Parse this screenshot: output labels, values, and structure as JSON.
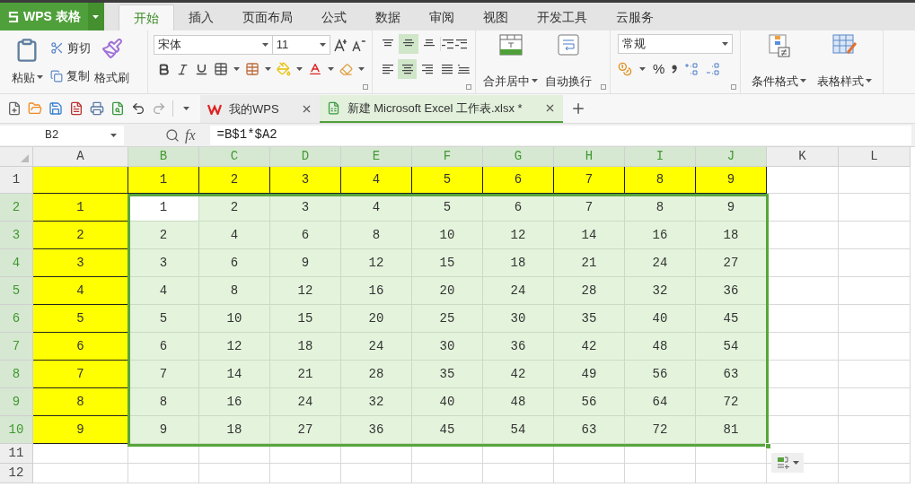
{
  "app": {
    "title": "WPS 表格"
  },
  "ribbon_tabs": [
    {
      "label": "开始",
      "selected": true
    },
    {
      "label": "插入",
      "selected": false
    },
    {
      "label": "页面布局",
      "selected": false
    },
    {
      "label": "公式",
      "selected": false
    },
    {
      "label": "数据",
      "selected": false
    },
    {
      "label": "审阅",
      "selected": false
    },
    {
      "label": "视图",
      "selected": false
    },
    {
      "label": "开发工具",
      "selected": false
    },
    {
      "label": "云服务",
      "selected": false
    }
  ],
  "clipboard": {
    "paste": "粘贴",
    "cut": "剪切",
    "copy": "复制",
    "format_painter": "格式刷"
  },
  "font": {
    "name": "宋体",
    "size": "11"
  },
  "horizontal_align": [
    {
      "selected": false
    },
    {
      "selected": true
    },
    {
      "selected": false
    },
    {
      "selected": false
    }
  ],
  "vertical_align": [
    {
      "selected": false
    },
    {
      "selected": true
    },
    {
      "selected": false
    }
  ],
  "alignment": {
    "merge": "合并居中",
    "wrap": "自动换行"
  },
  "number": {
    "format": "常规",
    "percent": "%"
  },
  "styles": {
    "conditional": "条件格式",
    "table_style": "表格样式"
  },
  "doc_tabs": [
    {
      "title": "我的WPS",
      "kind": "home",
      "selected": false
    },
    {
      "title": "新建 Microsoft Excel 工作表.xlsx *",
      "kind": "sheet",
      "selected": true
    }
  ],
  "formula_bar": {
    "name_box": "B2",
    "fx": "fx",
    "formula": "=B$1*$A2"
  },
  "columns": [
    {
      "label": "A",
      "in_selection": false
    },
    {
      "label": "B",
      "in_selection": true
    },
    {
      "label": "C",
      "in_selection": true
    },
    {
      "label": "D",
      "in_selection": true
    },
    {
      "label": "E",
      "in_selection": true
    },
    {
      "label": "F",
      "in_selection": true
    },
    {
      "label": "G",
      "in_selection": true
    },
    {
      "label": "H",
      "in_selection": true
    },
    {
      "label": "I",
      "in_selection": true
    },
    {
      "label": "J",
      "in_selection": true
    },
    {
      "label": "K",
      "in_selection": false
    },
    {
      "label": "L",
      "in_selection": false
    }
  ],
  "rows": [
    {
      "label": "1",
      "in_selection": false,
      "cells": [
        {
          "highlight": true
        },
        {
          "value": "1",
          "highlight": true
        },
        {
          "value": "2",
          "highlight": true
        },
        {
          "value": "3",
          "highlight": true
        },
        {
          "value": "4",
          "highlight": true
        },
        {
          "value": "5",
          "highlight": true
        },
        {
          "value": "6",
          "highlight": true
        },
        {
          "value": "7",
          "highlight": true
        },
        {
          "value": "8",
          "highlight": true
        },
        {
          "value": "9",
          "highlight": true
        },
        {},
        {}
      ]
    },
    {
      "label": "2",
      "in_selection": true,
      "cells": [
        {
          "value": "1",
          "highlight": true
        },
        {
          "value": "1",
          "in_selection": true,
          "selected": true
        },
        {
          "value": "2",
          "in_selection": true
        },
        {
          "value": "3",
          "in_selection": true
        },
        {
          "value": "4",
          "in_selection": true
        },
        {
          "value": "5",
          "in_selection": true
        },
        {
          "value": "6",
          "in_selection": true
        },
        {
          "value": "7",
          "in_selection": true
        },
        {
          "value": "8",
          "in_selection": true
        },
        {
          "value": "9",
          "in_selection": true
        },
        {},
        {}
      ]
    },
    {
      "label": "3",
      "in_selection": true,
      "cells": [
        {
          "value": "2",
          "highlight": true
        },
        {
          "value": "2",
          "in_selection": true
        },
        {
          "value": "4",
          "in_selection": true
        },
        {
          "value": "6",
          "in_selection": true
        },
        {
          "value": "8",
          "in_selection": true
        },
        {
          "value": "10",
          "in_selection": true
        },
        {
          "value": "12",
          "in_selection": true
        },
        {
          "value": "14",
          "in_selection": true
        },
        {
          "value": "16",
          "in_selection": true
        },
        {
          "value": "18",
          "in_selection": true
        },
        {},
        {}
      ]
    },
    {
      "label": "4",
      "in_selection": true,
      "cells": [
        {
          "value": "3",
          "highlight": true
        },
        {
          "value": "3",
          "in_selection": true
        },
        {
          "value": "6",
          "in_selection": true
        },
        {
          "value": "9",
          "in_selection": true
        },
        {
          "value": "12",
          "in_selection": true
        },
        {
          "value": "15",
          "in_selection": true
        },
        {
          "value": "18",
          "in_selection": true
        },
        {
          "value": "21",
          "in_selection": true
        },
        {
          "value": "24",
          "in_selection": true
        },
        {
          "value": "27",
          "in_selection": true
        },
        {},
        {}
      ]
    },
    {
      "label": "5",
      "in_selection": true,
      "cells": [
        {
          "value": "4",
          "highlight": true
        },
        {
          "value": "4",
          "in_selection": true
        },
        {
          "value": "8",
          "in_selection": true
        },
        {
          "value": "12",
          "in_selection": true
        },
        {
          "value": "16",
          "in_selection": true
        },
        {
          "value": "20",
          "in_selection": true
        },
        {
          "value": "24",
          "in_selection": true
        },
        {
          "value": "28",
          "in_selection": true
        },
        {
          "value": "32",
          "in_selection": true
        },
        {
          "value": "36",
          "in_selection": true
        },
        {},
        {}
      ]
    },
    {
      "label": "6",
      "in_selection": true,
      "cells": [
        {
          "value": "5",
          "highlight": true
        },
        {
          "value": "5",
          "in_selection": true
        },
        {
          "value": "10",
          "in_selection": true
        },
        {
          "value": "15",
          "in_selection": true
        },
        {
          "value": "20",
          "in_selection": true
        },
        {
          "value": "25",
          "in_selection": true
        },
        {
          "value": "30",
          "in_selection": true
        },
        {
          "value": "35",
          "in_selection": true
        },
        {
          "value": "40",
          "in_selection": true
        },
        {
          "value": "45",
          "in_selection": true
        },
        {},
        {}
      ]
    },
    {
      "label": "7",
      "in_selection": true,
      "cells": [
        {
          "value": "6",
          "highlight": true
        },
        {
          "value": "6",
          "in_selection": true
        },
        {
          "value": "12",
          "in_selection": true
        },
        {
          "value": "18",
          "in_selection": true
        },
        {
          "value": "24",
          "in_selection": true
        },
        {
          "value": "30",
          "in_selection": true
        },
        {
          "value": "36",
          "in_selection": true
        },
        {
          "value": "42",
          "in_selection": true
        },
        {
          "value": "48",
          "in_selection": true
        },
        {
          "value": "54",
          "in_selection": true
        },
        {},
        {}
      ]
    },
    {
      "label": "8",
      "in_selection": true,
      "cells": [
        {
          "value": "7",
          "highlight": true
        },
        {
          "value": "7",
          "in_selection": true
        },
        {
          "value": "14",
          "in_selection": true
        },
        {
          "value": "21",
          "in_selection": true
        },
        {
          "value": "28",
          "in_selection": true
        },
        {
          "value": "35",
          "in_selection": true
        },
        {
          "value": "42",
          "in_selection": true
        },
        {
          "value": "49",
          "in_selection": true
        },
        {
          "value": "56",
          "in_selection": true
        },
        {
          "value": "63",
          "in_selection": true
        },
        {},
        {}
      ]
    },
    {
      "label": "9",
      "in_selection": true,
      "cells": [
        {
          "value": "8",
          "highlight": true
        },
        {
          "value": "8",
          "in_selection": true
        },
        {
          "value": "16",
          "in_selection": true
        },
        {
          "value": "24",
          "in_selection": true
        },
        {
          "value": "32",
          "in_selection": true
        },
        {
          "value": "40",
          "in_selection": true
        },
        {
          "value": "48",
          "in_selection": true
        },
        {
          "value": "56",
          "in_selection": true
        },
        {
          "value": "64",
          "in_selection": true
        },
        {
          "value": "72",
          "in_selection": true
        },
        {},
        {}
      ]
    },
    {
      "label": "10",
      "in_selection": true,
      "cells": [
        {
          "value": "9",
          "highlight": true
        },
        {
          "value": "9",
          "in_selection": true
        },
        {
          "value": "18",
          "in_selection": true
        },
        {
          "value": "27",
          "in_selection": true
        },
        {
          "value": "36",
          "in_selection": true
        },
        {
          "value": "45",
          "in_selection": true
        },
        {
          "value": "54",
          "in_selection": true
        },
        {
          "value": "63",
          "in_selection": true
        },
        {
          "value": "72",
          "in_selection": true
        },
        {
          "value": "81",
          "in_selection": true
        },
        {},
        {}
      ]
    },
    {
      "label": "11",
      "in_selection": false,
      "cells": [
        {},
        {},
        {},
        {},
        {},
        {},
        {},
        {},
        {},
        {},
        {},
        {}
      ]
    },
    {
      "label": "12",
      "in_selection": false,
      "cells": [
        {},
        {},
        {},
        {},
        {},
        {},
        {},
        {},
        {},
        {},
        {},
        {}
      ]
    }
  ]
}
